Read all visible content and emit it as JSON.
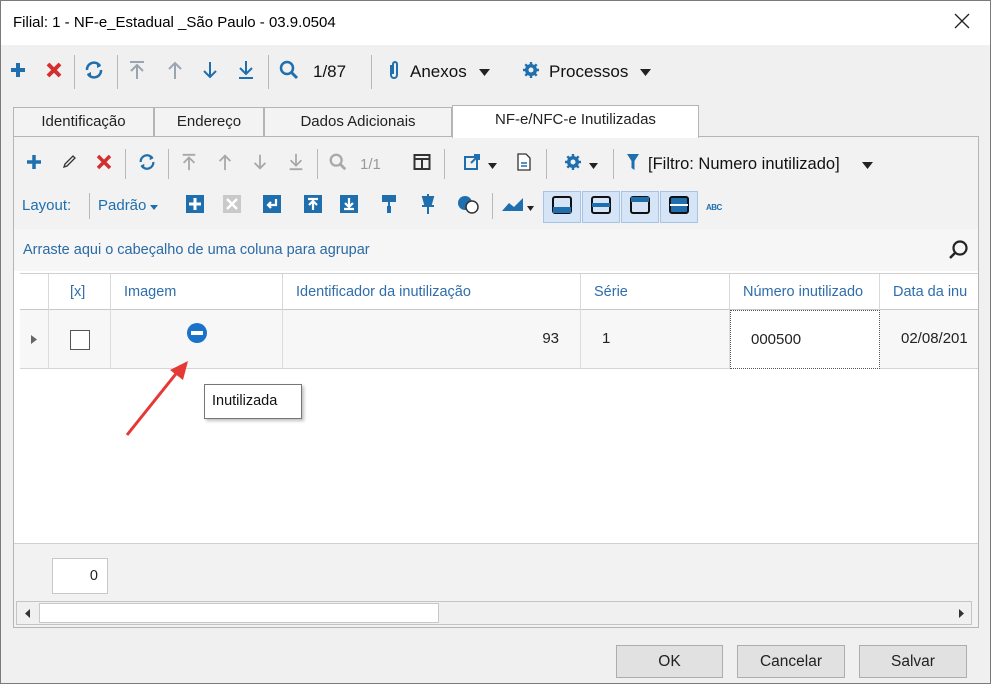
{
  "window": {
    "title": "Filial: 1 - NF-e_Estadual _São Paulo - 03.9.0504",
    "close_icon": "close-icon"
  },
  "main_toolbar": {
    "icons": [
      "plus-icon",
      "delete-icon",
      "refresh-icon",
      "first-icon",
      "up-icon",
      "down-icon",
      "last-icon",
      "search-icon",
      "paperclip-icon",
      "gear-icon"
    ],
    "record_position": "1/87",
    "anexos_label": "Anexos",
    "processos_label": "Processos"
  },
  "tabs": [
    {
      "label": "Identificação",
      "active": false
    },
    {
      "label": "Endereço",
      "active": false
    },
    {
      "label": "Dados Adicionais",
      "active": false
    },
    {
      "label": "NF-e/NFC-e Inutilizadas",
      "active": true
    }
  ],
  "grid_toolbar": {
    "record_position": "1/1",
    "filter_label": "[Filtro: Numero inutilizado]",
    "layout_label": "Layout:",
    "layout_value": "Padrão",
    "abc_label": "ABC"
  },
  "grid": {
    "group_hint": "Arraste aqui o cabeçalho de uma coluna para agrupar",
    "columns": [
      "[x]",
      "Imagem",
      "Identificador da inutilização",
      "Série",
      "Número inutilizado",
      "Data da inu"
    ],
    "rows": [
      {
        "checked": false,
        "image_icon": "inutilizada-icon",
        "identificador": "93",
        "serie": "1",
        "numero": "000500",
        "data": "02/08/201"
      }
    ],
    "tooltip": "Inutilizada",
    "record_count": "0"
  },
  "buttons": {
    "ok": "OK",
    "cancel": "Cancelar",
    "save": "Salvar"
  },
  "colors": {
    "accent_blue": "#1f6fae",
    "delete_red": "#d32f2f",
    "arrow_red": "#e53935",
    "header_text": "#2f6dab"
  }
}
